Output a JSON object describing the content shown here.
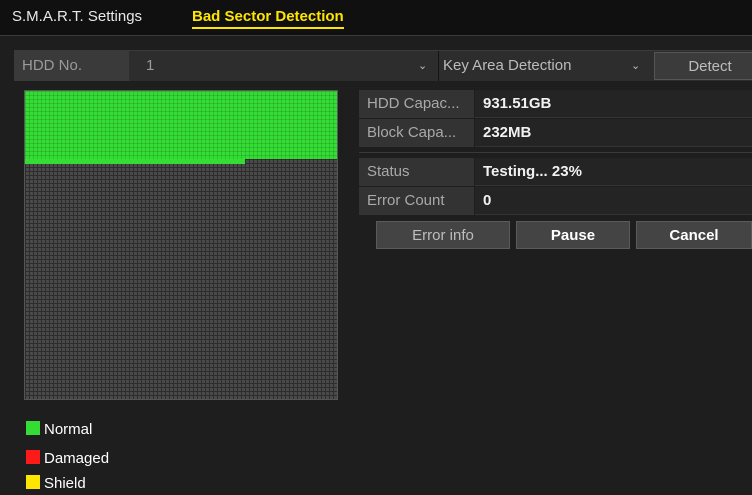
{
  "tabs": {
    "smart_settings": "S.M.A.R.T. Settings",
    "bad_sector_detection": "Bad Sector Detection"
  },
  "selector": {
    "hdd_label": "HDD No.",
    "hdd_value": "1",
    "mode_value": "Key Area Detection",
    "detect_label": "Detect"
  },
  "info": {
    "hdd_capacity_label": "HDD Capac...",
    "hdd_capacity_value": "931.51GB",
    "block_capacity_label": "Block Capa...",
    "block_capacity_value": "232MB",
    "status_label": "Status",
    "status_value": "Testing... 23%",
    "error_count_label": "Error Count",
    "error_count_value": "0"
  },
  "progress": {
    "fraction_tested": 0.23
  },
  "buttons": {
    "error_info": "Error info",
    "pause": "Pause",
    "cancel": "Cancel"
  },
  "legend": [
    {
      "label": "Normal",
      "color": "#33dd33"
    },
    {
      "label": "Damaged",
      "color": "#ff1a1a"
    },
    {
      "label": "Shield",
      "color": "#ffe600"
    }
  ],
  "colors": {
    "active_tab": "#ffe600",
    "normal": "#33dd33",
    "untested": "#4a4a4a"
  }
}
